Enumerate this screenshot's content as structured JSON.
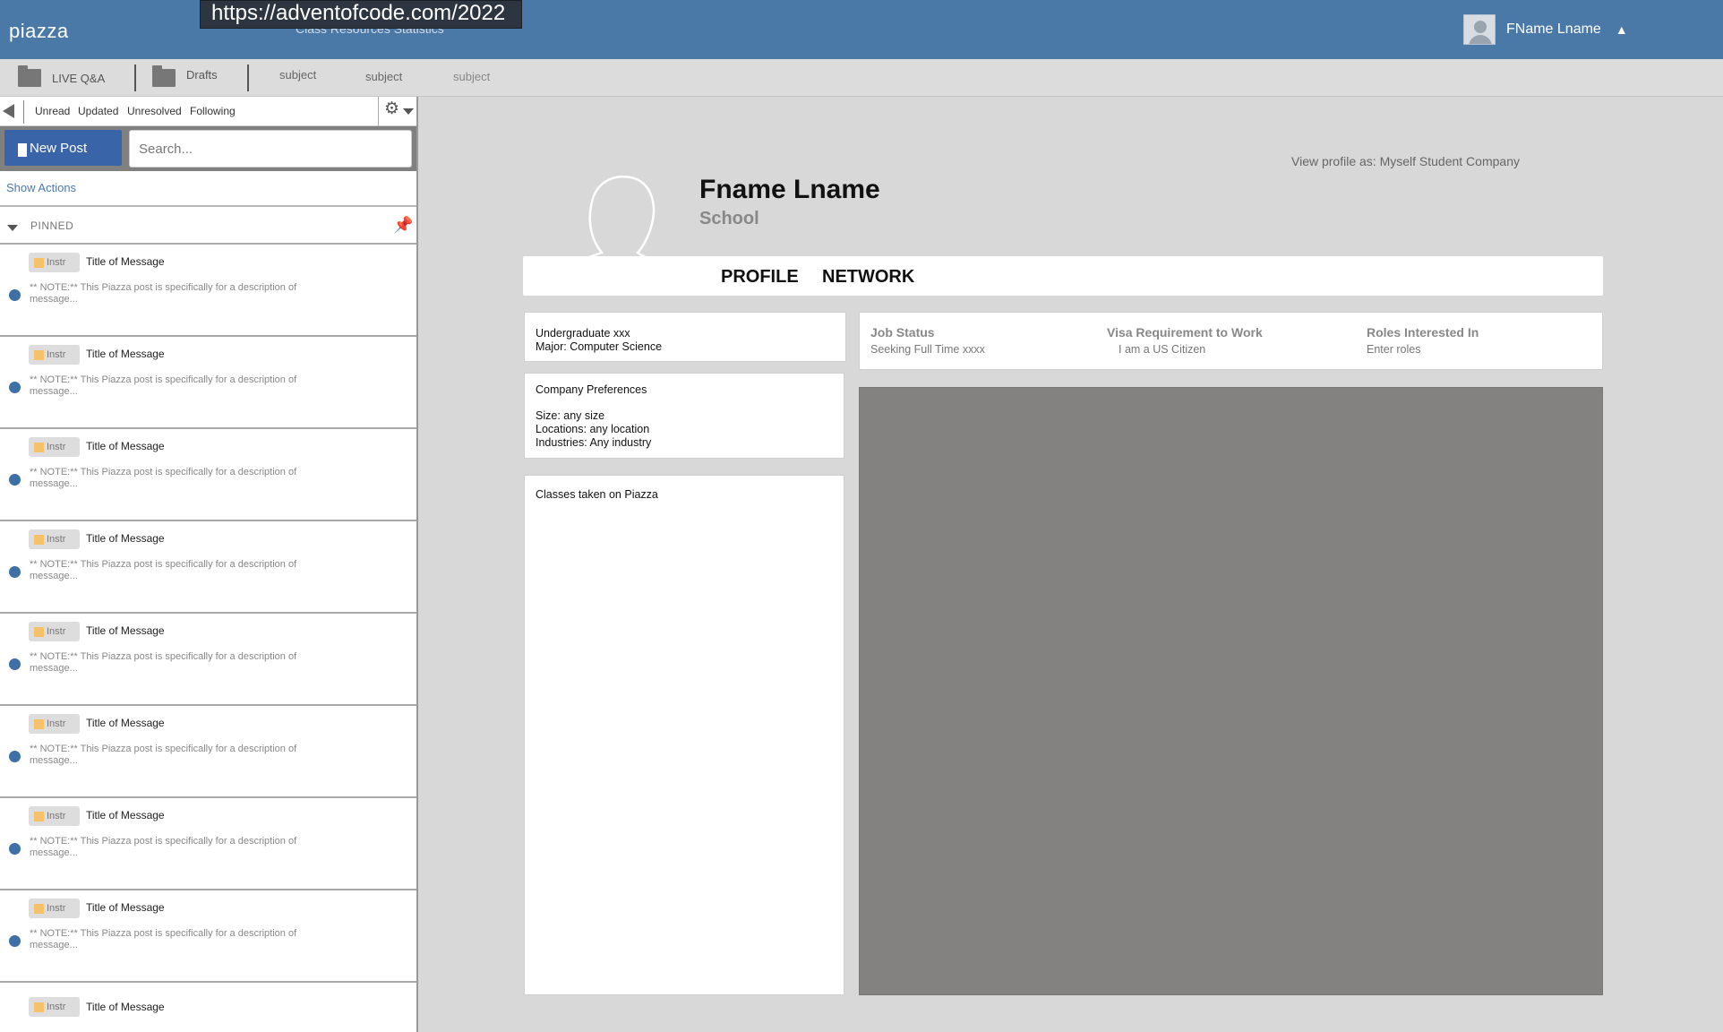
{
  "app": {
    "logo": "piazza"
  },
  "url_tooltip": "https://adventofcode.com/2022",
  "top_nav_obscured": "Class   Resources   Statistics",
  "user": {
    "name": "FName Lname",
    "caret": "▲"
  },
  "folders": {
    "live_qa": "LIVE Q&A",
    "drafts": "Drafts",
    "subjects": [
      "subject",
      "subject",
      "subject"
    ]
  },
  "filters": [
    "Unread",
    "Updated",
    "Unresolved",
    "Following"
  ],
  "actions": {
    "new_post": "New Post",
    "search_placeholder": "Search...",
    "show_actions": "Show Actions"
  },
  "pinned_label": "PINNED",
  "posts": [
    {
      "badge": "Instr",
      "title": "Title of Message",
      "desc": "** NOTE:** This Piazza post is specifically for a description of message..."
    },
    {
      "badge": "Instr",
      "title": "Title of Message",
      "desc": "** NOTE:** This Piazza post is specifically for a description of message..."
    },
    {
      "badge": "Instr",
      "title": "Title of Message",
      "desc": "** NOTE:** This Piazza post is specifically for a description of message..."
    },
    {
      "badge": "Instr",
      "title": "Title of Message",
      "desc": "** NOTE:** This Piazza post is specifically for a description of message..."
    },
    {
      "badge": "Instr",
      "title": "Title of Message",
      "desc": "** NOTE:** This Piazza post is specifically for a description of message..."
    },
    {
      "badge": "Instr",
      "title": "Title of Message",
      "desc": "** NOTE:** This Piazza post is specifically for a description of message..."
    },
    {
      "badge": "Instr",
      "title": "Title of Message",
      "desc": "** NOTE:** This Piazza post is specifically for a description of message..."
    },
    {
      "badge": "Instr",
      "title": "Title of Message",
      "desc": "** NOTE:** This Piazza post is specifically for a description of message..."
    },
    {
      "badge": "Instr",
      "title": "Title of Message",
      "desc": ""
    }
  ],
  "profile": {
    "view_as": "View profile as: Myself Student Company",
    "name": "Fname Lname",
    "school": "School",
    "tabs": [
      "PROFILE",
      "NETWORK"
    ],
    "education": {
      "degree": "Undergraduate xxx",
      "major": "Major: Computer Science"
    },
    "company_prefs": {
      "title": "Company Preferences",
      "size": "Size: any size",
      "locations": "Locations: any location",
      "industries": "Industries: Any industry"
    },
    "classes_title": "Classes taken on Piazza",
    "job_status": {
      "label": "Job Status",
      "value": "Seeking Full Time xxxx"
    },
    "visa": {
      "label": "Visa Requirement to Work",
      "value": "I am a US Citizen"
    },
    "roles": {
      "label": "Roles Interested In",
      "value": "Enter roles"
    }
  },
  "colors": {
    "topbar": "#4a79a8",
    "new_post": "#3a64a8",
    "unread_dot": "#3e6fa5",
    "badge_square": "#f7c06a",
    "placeholder": "#838281"
  }
}
